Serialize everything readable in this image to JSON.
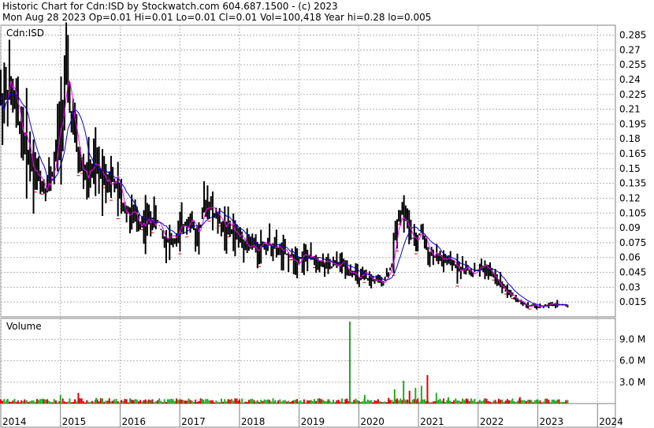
{
  "header": {
    "line1": "Historic Chart for Cdn:ISD by Stockwatch.com 604.687.1500 - (c) 2023",
    "line2": "Mon Aug 28 2023   Op=0.01  Hi=0.01  Lo=0.01  Cl=0.01  Vol=100,418  Year hi=0.28  lo=0.005"
  },
  "colors": {
    "price_bar": "#000000",
    "ma_short": "#ff00ff",
    "ma_long": "#0000cc",
    "volume_up": "#22aa22",
    "volume_down": "#dd0000",
    "grid": "#b0b0b0"
  },
  "chart_data": [
    {
      "type": "line",
      "title": "Cdn:ISD",
      "xlabel": "",
      "ylabel": "",
      "ylim": [
        0.0,
        0.295
      ],
      "grid": true,
      "y_ticks": [
        "0.285",
        "0.27",
        "0.255",
        "0.24",
        "0.225",
        "0.21",
        "0.195",
        "0.18",
        "0.165",
        "0.15",
        "0.135",
        "0.12",
        "0.105",
        "0.09",
        "0.075",
        "0.06",
        "0.045",
        "0.03",
        "0.015"
      ],
      "x_ticks": [
        "2014",
        "2015",
        "2016",
        "2017",
        "2018",
        "2019",
        "2020",
        "2021",
        "2022",
        "2023",
        "2024"
      ],
      "x_range": [
        2014.0,
        2024.3
      ],
      "series": [
        {
          "x": [
            2014.0,
            2014.15,
            2014.3,
            2014.45,
            2014.6,
            2014.75,
            2014.9,
            2015.0,
            2015.1,
            2015.2,
            2015.3,
            2015.45,
            2015.6,
            2015.75,
            2015.9,
            2016.0,
            2016.2,
            2016.4,
            2016.6,
            2016.75,
            2016.9,
            2017.0,
            2017.15,
            2017.3,
            2017.45,
            2017.6,
            2017.75,
            2017.9,
            2018.0,
            2018.15,
            2018.3,
            2018.5,
            2018.7,
            2018.9,
            2019.1,
            2019.3,
            2019.5,
            2019.7,
            2019.9,
            2020.0,
            2020.2,
            2020.4,
            2020.55,
            2020.65,
            2020.75,
            2020.85,
            2020.95,
            2021.05,
            2021.15,
            2021.3,
            2021.5,
            2021.7,
            2021.9,
            2022.1,
            2022.3,
            2022.45,
            2022.6,
            2022.8,
            2023.0,
            2023.2,
            2023.35,
            2023.5
          ],
          "values": [
            0.22,
            0.23,
            0.2,
            0.17,
            0.145,
            0.13,
            0.15,
            0.2,
            0.24,
            0.2,
            0.16,
            0.14,
            0.15,
            0.145,
            0.135,
            0.12,
            0.1,
            0.095,
            0.1,
            0.08,
            0.075,
            0.085,
            0.1,
            0.08,
            0.12,
            0.1,
            0.09,
            0.085,
            0.08,
            0.075,
            0.07,
            0.075,
            0.065,
            0.06,
            0.06,
            0.058,
            0.05,
            0.055,
            0.045,
            0.04,
            0.038,
            0.035,
            0.05,
            0.1,
            0.11,
            0.09,
            0.07,
            0.09,
            0.065,
            0.06,
            0.055,
            0.05,
            0.045,
            0.05,
            0.04,
            0.03,
            0.02,
            0.012,
            0.01,
            0.012,
            0.013,
            0.011
          ]
        }
      ]
    },
    {
      "type": "bar",
      "title": "Volume",
      "xlabel": "",
      "ylabel": "",
      "ylim": [
        0,
        11500000
      ],
      "y_ticks": [
        "9.0 M",
        "6.0 M",
        "3.0 M"
      ],
      "series": [
        {
          "x": [
            2014.1,
            2014.4,
            2014.7,
            2015.0,
            2015.3,
            2015.6,
            2015.9,
            2016.2,
            2016.5,
            2016.8,
            2017.1,
            2017.4,
            2017.7,
            2018.0,
            2018.3,
            2018.6,
            2018.9,
            2019.2,
            2019.5,
            2019.8,
            2019.85,
            2020.1,
            2020.5,
            2020.6,
            2020.75,
            2020.85,
            2020.95,
            2021.05,
            2021.15,
            2021.3,
            2021.5,
            2021.8,
            2022.1,
            2022.4,
            2022.7,
            2023.0,
            2023.3
          ],
          "values": [
            500000,
            600000,
            700000,
            1200000,
            1500000,
            800000,
            600000,
            500000,
            500000,
            600000,
            400000,
            500000,
            400000,
            600000,
            400000,
            500000,
            400000,
            500000,
            600000,
            700000,
            11500000,
            1200000,
            800000,
            2000000,
            3200000,
            1800000,
            2200000,
            2500000,
            4000000,
            1500000,
            900000,
            700000,
            600000,
            500000,
            900000,
            600000,
            400000
          ]
        }
      ]
    }
  ]
}
